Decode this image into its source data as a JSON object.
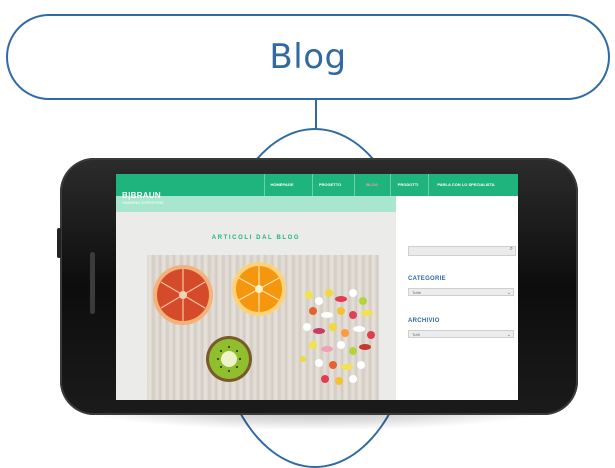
{
  "callout": {
    "title": "Blog"
  },
  "site": {
    "logo": "B|BRAUN",
    "tagline": "SHARING EXPERTISE",
    "nav": [
      {
        "label": "HOMEPAGE",
        "active": false
      },
      {
        "label": "PROGETTO",
        "active": false
      },
      {
        "label": "BLOG",
        "active": true
      },
      {
        "label": "PRODOTTI",
        "active": false
      },
      {
        "label": "PARLA CON LO SPECIALISTA",
        "active": false
      }
    ],
    "main": {
      "heading": "ARTICOLI DAL BLOG"
    },
    "sidebar": {
      "search_placeholder": "",
      "categories": {
        "title": "CATEGORIE",
        "selected": "Tutte"
      },
      "archive": {
        "title": "ARCHIVIO",
        "selected": "Tutti"
      }
    }
  },
  "colors": {
    "accent": "#2f6aa3",
    "brand_green": "#1fb47d",
    "light_green": "#a9e6cf",
    "active_nav": "#f0a0a8"
  }
}
